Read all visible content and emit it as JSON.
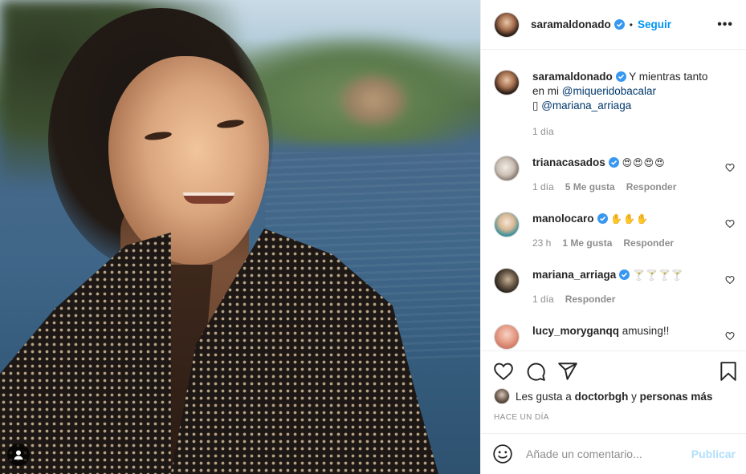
{
  "post": {
    "username": "saramaldonado",
    "follow_label": "Seguir",
    "separator": "•",
    "more_label": "•••",
    "caption_text": "Y mientras tanto en mi",
    "caption_mention_1": "@miqueridobacalar",
    "caption_glyph": "▯",
    "caption_mention_2": "@mariana_arriaga",
    "caption_time": "1 día"
  },
  "comments": [
    {
      "username": "trianacasados",
      "text": "😍😍😍😍",
      "time": "1 día",
      "likes": "5 Me gusta",
      "reply": "Responder"
    },
    {
      "username": "manolocaro",
      "text": "✋✋✋",
      "time": "23 h",
      "likes": "1 Me gusta",
      "reply": "Responder"
    },
    {
      "username": "mariana_arriaga",
      "text": "🍸🍸🍸🍸",
      "time": "1 día",
      "reply": "Responder"
    },
    {
      "username": "lucy_moryganqq",
      "text": "amusing!!"
    }
  ],
  "likes_line": {
    "prefix": "Les gusta a",
    "user": "doctorbgh",
    "joiner": "y",
    "others": "personas más"
  },
  "timestamp": "HACE UN DÍA",
  "composer": {
    "placeholder": "Añade un comentario...",
    "publish_label": "Publicar"
  },
  "colors": {
    "accent": "#0095f6",
    "publish_disabled": "#b2dffc",
    "verified": "#3897f0"
  }
}
